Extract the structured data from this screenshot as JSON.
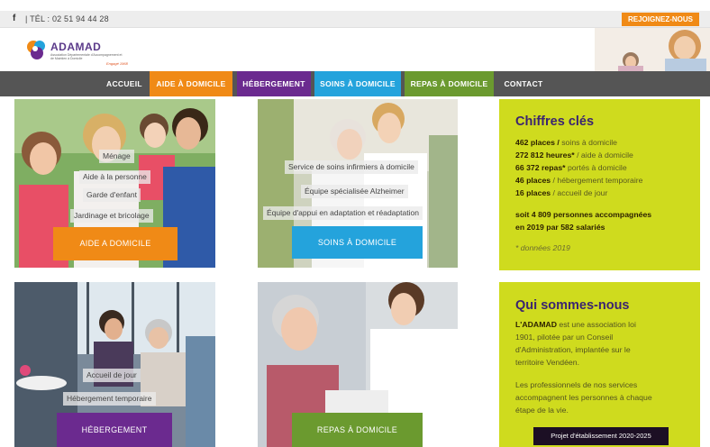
{
  "topbar": {
    "facebook": "f",
    "phone": "| TÉL : 02 51 94 44 28",
    "join": "REJOIGNEZ-NOUS"
  },
  "logo": {
    "name": "ADAMAD",
    "subtitle": "Association Départementale d'Accompagnement et de Maintien à Domicile",
    "slogan": "Engagé 1968"
  },
  "nav": [
    {
      "label": "ACCUEIL",
      "bg": "#555555"
    },
    {
      "label": "AIDE À DOMICILE",
      "bg": "#f08a16"
    },
    {
      "label": "HÉBERGEMENT",
      "bg": "#6b2a8f"
    },
    {
      "label": "SOINS À DOMICILE",
      "bg": "#24a3dc"
    },
    {
      "label": "REPAS À DOMICILE",
      "bg": "#6b9a2f"
    },
    {
      "label": "CONTACT",
      "bg": "#555555"
    }
  ],
  "tiles": {
    "aide": {
      "chips": [
        "Ménage",
        "Aide à la personne",
        "Garde d'enfant",
        "Jardinage et bricolage"
      ],
      "cta": "AIDE A DOMICILE",
      "color": "#f08a16"
    },
    "soins": {
      "chips": [
        "Service de soins infirmiers à domicile",
        "Équipe spécialisée Alzheimer",
        "Équipe d'appui en adaptation et réadaptation"
      ],
      "cta": "SOINS À DOMICILE",
      "color": "#24a3dc"
    },
    "hebergement": {
      "chips": [
        "Accueil de jour",
        "Hébergement temporaire"
      ],
      "cta": "HÉBERGEMENT",
      "color": "#6b2a8f"
    },
    "repas": {
      "cta": "REPAS À DOMICILE",
      "color": "#6b9a2f"
    }
  },
  "chiffres": {
    "title": "Chiffres clés",
    "stats": [
      {
        "value": "462 places /",
        "label": " soins à domicile"
      },
      {
        "value": "272 812 heures*",
        "label": " / aide à domicile"
      },
      {
        "value": "66 372 repas*",
        "label": " portés à domicile"
      },
      {
        "value": "46 places",
        "label": " / hébergement temporaire"
      },
      {
        "value": "16 places",
        "label": " / accueil de jour"
      }
    ],
    "summary1": "soit 4 809 personnes accompagnées",
    "summary2": "en 2019 par 582 salariés",
    "note": "* données 2019"
  },
  "qui": {
    "title": "Qui sommes-nous",
    "p1_bold": "L'ADAMAD",
    "p1_lines": [
      " est une association loi",
      "1901, pilotée par un Conseil",
      "d'Administration, implantée sur le",
      "territoire Vendéen."
    ],
    "p2_lines": [
      "Les professionnels de nos services",
      "accompagnent les personnes à chaque",
      "étape de la vie."
    ],
    "button": "Projet d'établissement 2020-2025"
  },
  "colors": {
    "lime": "#cfdb1e",
    "purple": "#3b2470",
    "nav": "#555555"
  }
}
